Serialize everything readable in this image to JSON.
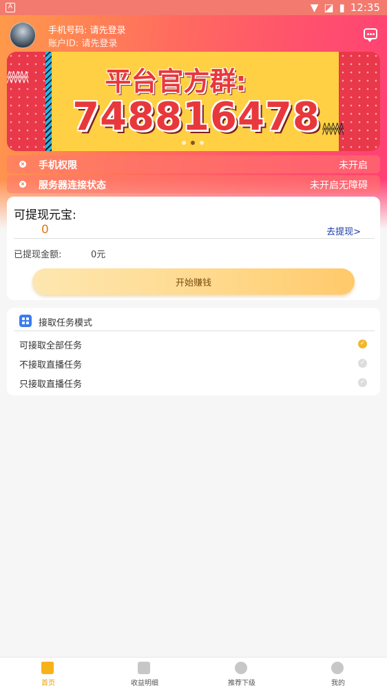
{
  "status_bar": {
    "left_icon": "A",
    "time": "12:35"
  },
  "user": {
    "phone_text": "手机号码:  请先登录",
    "id_text": "账户ID:  请先登录"
  },
  "banner": {
    "title": "平台官方群:",
    "number": "748816478"
  },
  "permissions": [
    {
      "label": "手机权限",
      "value": "未开启"
    },
    {
      "label": "服务器连接状态",
      "value": "未开启无障碍"
    }
  ],
  "wallet": {
    "title": "可提现元宝:",
    "amount": "0",
    "withdraw_link": "去提现>",
    "withdrawn_label": "已提现金额:",
    "withdrawn_value": "0元",
    "start_button": "开始赚钱"
  },
  "task_mode": {
    "title": "接取任务模式",
    "options": [
      {
        "label": "可接取全部任务",
        "selected": true
      },
      {
        "label": "不接取直播任务",
        "selected": false
      },
      {
        "label": "只接取直播任务",
        "selected": false
      }
    ]
  },
  "tabbar": {
    "tabs": [
      {
        "label": "首页",
        "icon": "home-icon",
        "active": true
      },
      {
        "label": "收益明细",
        "icon": "income-icon",
        "active": false
      },
      {
        "label": "推荐下级",
        "icon": "users-icon",
        "active": false
      },
      {
        "label": "我的",
        "icon": "profile-icon",
        "active": false
      }
    ]
  },
  "colors": {
    "accent": "#f7b21a",
    "link": "#1a3aa8",
    "amount": "#e07a1b"
  }
}
